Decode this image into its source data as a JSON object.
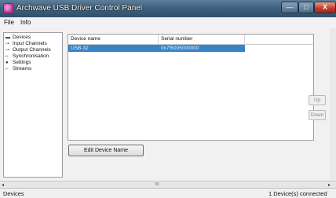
{
  "window": {
    "title": "Archwave USB Driver Control Panel",
    "app_icon": "archwave-logo-icon",
    "controls": {
      "minimize": "—",
      "maximize": "□",
      "close": "X"
    }
  },
  "menu": {
    "items": [
      "File",
      "Info"
    ]
  },
  "sidebar": {
    "items": [
      {
        "label": "Devices",
        "icon": "devices-icon",
        "glyph": "▬"
      },
      {
        "label": "Input Channels",
        "icon": "input-channels-icon",
        "glyph": "⊸"
      },
      {
        "label": "Output Channels",
        "icon": "output-channels-icon",
        "glyph": "⊸"
      },
      {
        "label": "Synchronisation",
        "icon": "sync-icon",
        "glyph": "⌐"
      },
      {
        "label": "Settings",
        "icon": "settings-icon",
        "glyph": "●"
      },
      {
        "label": "Streams",
        "icon": "streams-icon",
        "glyph": "⌐"
      }
    ]
  },
  "device_table": {
    "columns": [
      "Device name",
      "Serial number",
      ""
    ],
    "rows": [
      {
        "name": "USB-32",
        "serial": "0x7f5005000000",
        "selected": true
      }
    ]
  },
  "buttons": {
    "edit_device_name": "Edit Device Name",
    "up": "Up",
    "down": "Down"
  },
  "scrollbar": {
    "left": "◂",
    "grip": "III",
    "right": "▸"
  },
  "status": {
    "left": "Devices",
    "right": "1 Device(s) connected"
  },
  "colors": {
    "selection": "#3584c6",
    "titlebar": "#3f6280"
  }
}
